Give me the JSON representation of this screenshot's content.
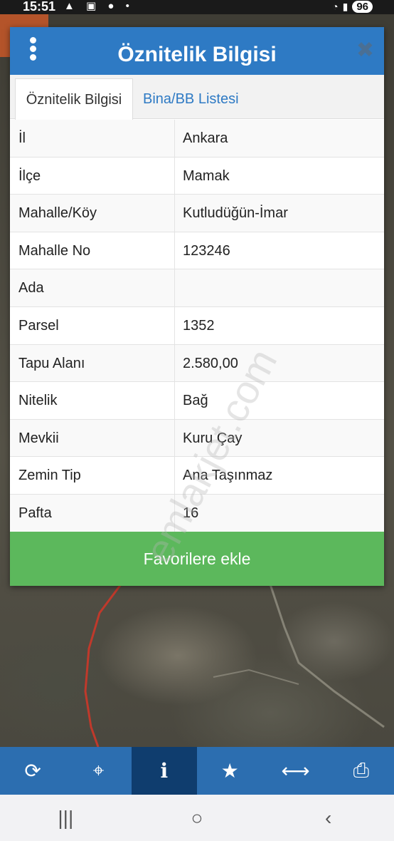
{
  "status_bar": {
    "time": "15:51",
    "battery": "96"
  },
  "dialog": {
    "title": "Öznitelik Bilgisi",
    "tabs": [
      {
        "label": "Öznitelik Bilgisi",
        "active": true
      },
      {
        "label": "Bina/BB Listesi",
        "active": false
      }
    ],
    "rows": [
      {
        "label": "İl",
        "value": "Ankara"
      },
      {
        "label": "İlçe",
        "value": "Mamak"
      },
      {
        "label": "Mahalle/Köy",
        "value": "Kutludüğün-İmar"
      },
      {
        "label": "Mahalle No",
        "value": "123246"
      },
      {
        "label": "Ada",
        "value": ""
      },
      {
        "label": "Parsel",
        "value": "1352"
      },
      {
        "label": "Tapu Alanı",
        "value": "2.580,00"
      },
      {
        "label": "Nitelik",
        "value": "Bağ"
      },
      {
        "label": "Mevkii",
        "value": "Kuru Çay"
      },
      {
        "label": "Zemin Tip",
        "value": "Ana Taşınmaz"
      },
      {
        "label": "Pafta",
        "value": "16"
      }
    ],
    "favorite_button": "Favorilere ekle"
  },
  "watermark": "emlakjet.com",
  "toolbar": {
    "items": [
      {
        "icon": "refresh-icon",
        "active": false
      },
      {
        "icon": "locate-icon",
        "active": false
      },
      {
        "icon": "info-icon",
        "active": true
      },
      {
        "icon": "star-icon",
        "active": false
      },
      {
        "icon": "measure-icon",
        "active": false
      },
      {
        "icon": "print-icon",
        "active": false
      }
    ]
  },
  "colors": {
    "header": "#2e7ac4",
    "button": "#5cb85c",
    "toolbar": "#2c6eb0",
    "toolbar_active": "#0f3d6e"
  }
}
